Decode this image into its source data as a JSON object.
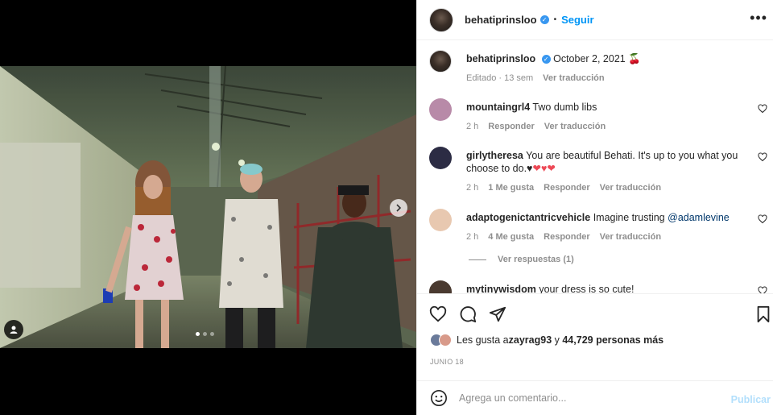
{
  "post": {
    "username": "behatiprinsloo",
    "follow_label": "Seguir",
    "more_label": "•••",
    "image_alt": "Backstage corridor photo",
    "carousel": {
      "count": 3,
      "active_index": 0
    }
  },
  "caption": {
    "username": "behatiprinsloo",
    "text": "October 2, 2021",
    "emoji": "🍒",
    "edited": "Editado · 13 sem",
    "translate": "Ver traducción"
  },
  "comments": [
    {
      "username": "mountaingrl4",
      "text": "Two dumb libs",
      "time": "2 h",
      "likes": "",
      "reply": "Responder",
      "translate": "Ver traducción",
      "avatar_color": "#b88aa8"
    },
    {
      "username": "girlytheresa",
      "text": "You are beautiful Behati. It's up to you what you choose to do.♥",
      "hearts": "❤♥❤",
      "time": "2 h",
      "likes": "1 Me gusta",
      "reply": "Responder",
      "translate": "Ver traducción",
      "avatar_color": "#2c2c44"
    },
    {
      "username": "adaptogenictantricvehicle",
      "text": "Imagine trusting ",
      "mention": "@adamlevine",
      "time": "2 h",
      "likes": "4 Me gusta",
      "reply": "Responder",
      "translate": "Ver traducción",
      "avatar_color": "#e8c8b0"
    },
    {
      "username": "mytinywisdom",
      "text": "your dress is so cute!",
      "avatar_color": "#4a3a30"
    }
  ],
  "view_replies": "Ver respuestas (1)",
  "likes": {
    "prefix": "Les gusta a ",
    "user": "zayrag93",
    "middle": " y ",
    "count": "44,729 personas más"
  },
  "date": "JUNIO 18",
  "add_comment": {
    "placeholder": "Agrega un comentario...",
    "publish": "Publicar"
  },
  "colors": {
    "accent": "#0095f6",
    "publish_disabled": "#b2dffc",
    "heart_red": "#ed4956"
  }
}
